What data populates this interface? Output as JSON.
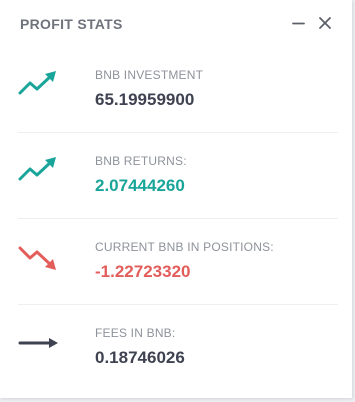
{
  "panel": {
    "title": "PROFIT STATS",
    "minimize_icon": "minimize-icon",
    "close_icon": "close-icon"
  },
  "colors": {
    "positive": "#1aa59a",
    "negative": "#e35d5b",
    "neutral": "#3f4351",
    "label": "#8e929a",
    "title": "#6f737b"
  },
  "stats": [
    {
      "label": "BNB INVESTMENT",
      "value": "65.19959900",
      "icon": "trend-up-icon",
      "value_color": "#3f4351"
    },
    {
      "label": "BNB RETURNS:",
      "value": "2.07444260",
      "icon": "trend-up-icon",
      "value_color": "#1aa59a"
    },
    {
      "label": "CURRENT BNB IN POSITIONS:",
      "value": "-1.22723320",
      "icon": "trend-down-icon",
      "value_color": "#e35d5b"
    },
    {
      "label": "FEES IN BNB:",
      "value": "0.18746026",
      "icon": "arrow-right-icon",
      "value_color": "#3f4351"
    }
  ]
}
